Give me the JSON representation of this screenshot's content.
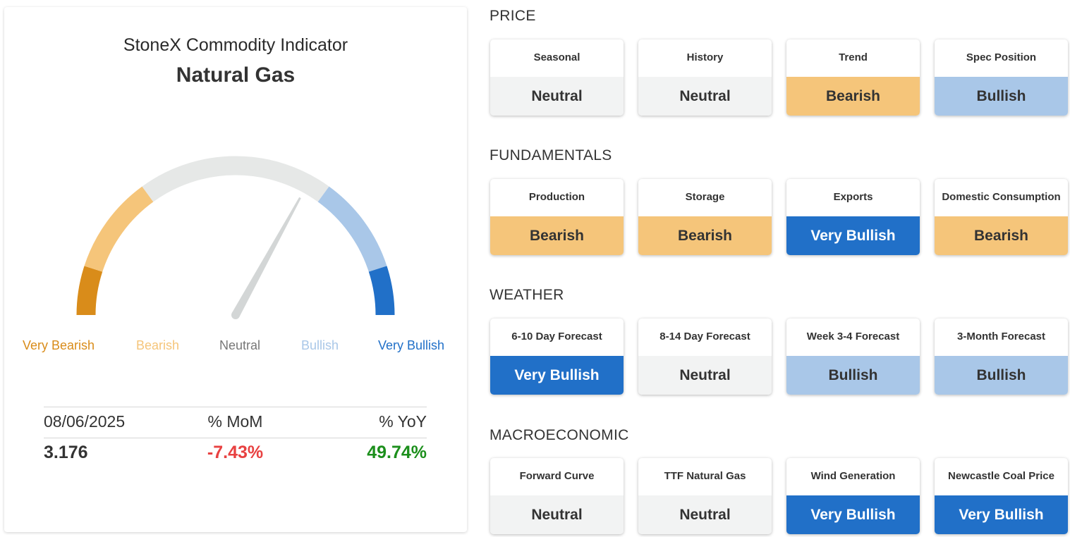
{
  "indicator": {
    "title": "StoneX Commodity Indicator",
    "commodity": "Natural Gas",
    "gauge": {
      "value": 0.66,
      "segments": [
        {
          "label": "Very Bearish",
          "color": "#d98c1a",
          "from": 0.0,
          "to": 0.1
        },
        {
          "label": "Bearish",
          "color": "#f5c57a",
          "from": 0.1,
          "to": 0.3
        },
        {
          "label": "Neutral",
          "color": "#e6e8e7",
          "from": 0.3,
          "to": 0.7
        },
        {
          "label": "Bullish",
          "color": "#a9c7e8",
          "from": 0.7,
          "to": 0.9
        },
        {
          "label": "Very Bullish",
          "color": "#2170c8",
          "from": 0.9,
          "to": 1.0
        }
      ],
      "needle_color": "#d3d6d6"
    },
    "legend": [
      {
        "label": "Very Bearish",
        "color": "#d98c1a"
      },
      {
        "label": "Bearish",
        "color": "#f5c57a"
      },
      {
        "label": "Neutral",
        "color": "#777777"
      },
      {
        "label": "Bullish",
        "color": "#a9c7e8"
      },
      {
        "label": "Very Bullish",
        "color": "#2170c8"
      }
    ],
    "stats": {
      "date": "08/06/2025",
      "mom_label": "% MoM",
      "yoy_label": "% YoY",
      "price": "3.176",
      "mom": "-7.43%",
      "yoy": "49.74%",
      "mom_color": "#e84141",
      "yoy_color": "#1c8f1c"
    }
  },
  "status_styles": {
    "Neutral": {
      "bg": "#f2f3f3",
      "fg": "#333333"
    },
    "Bearish": {
      "bg": "#f5c57a",
      "fg": "#333333"
    },
    "Bullish": {
      "bg": "#a9c7e8",
      "fg": "#333333"
    },
    "Very Bullish": {
      "bg": "#2170c8",
      "fg": "#ffffff"
    }
  },
  "sections": [
    {
      "title": "PRICE",
      "tiles": [
        {
          "label": "Seasonal",
          "status": "Neutral"
        },
        {
          "label": "History",
          "status": "Neutral"
        },
        {
          "label": "Trend",
          "status": "Bearish"
        },
        {
          "label": "Spec Position",
          "status": "Bullish"
        }
      ]
    },
    {
      "title": "FUNDAMENTALS",
      "tiles": [
        {
          "label": "Production",
          "status": "Bearish"
        },
        {
          "label": "Storage",
          "status": "Bearish"
        },
        {
          "label": "Exports",
          "status": "Very Bullish"
        },
        {
          "label": "Domestic Consumption",
          "status": "Bearish"
        }
      ]
    },
    {
      "title": "WEATHER",
      "tiles": [
        {
          "label": "6-10 Day Forecast",
          "status": "Very Bullish"
        },
        {
          "label": "8-14 Day Forecast",
          "status": "Neutral"
        },
        {
          "label": "Week 3-4 Forecast",
          "status": "Bullish"
        },
        {
          "label": "3-Month Forecast",
          "status": "Bullish"
        }
      ]
    },
    {
      "title": "MACROECONOMIC",
      "tiles": [
        {
          "label": "Forward Curve",
          "status": "Neutral"
        },
        {
          "label": "TTF Natural Gas",
          "status": "Neutral"
        },
        {
          "label": "Wind Generation",
          "status": "Very Bullish"
        },
        {
          "label": "Newcastle Coal Price",
          "status": "Very Bullish"
        }
      ]
    }
  ]
}
